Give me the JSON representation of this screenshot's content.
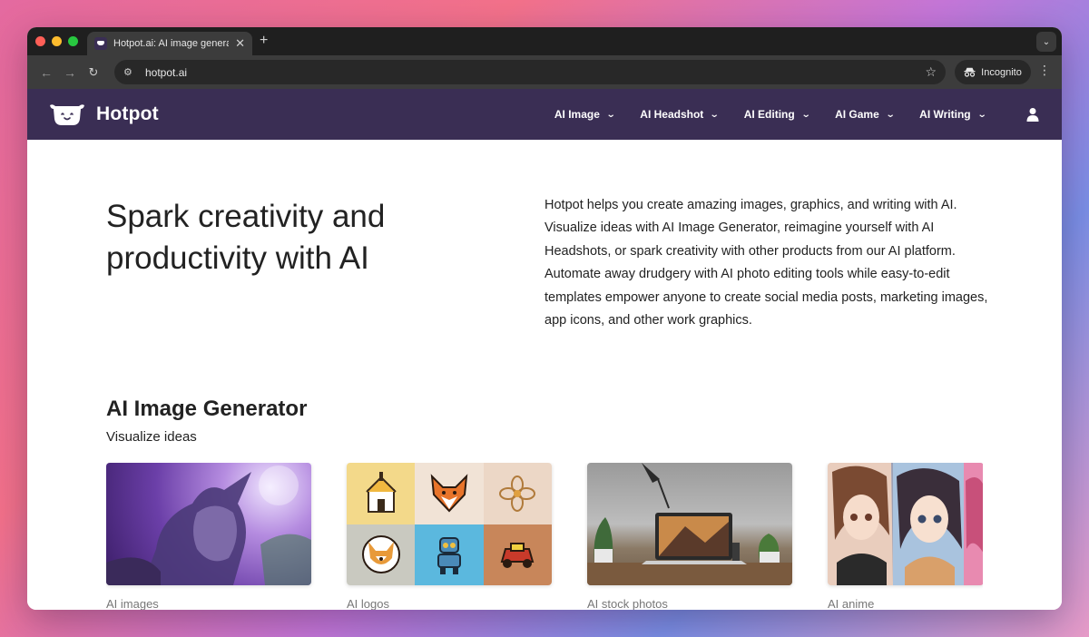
{
  "browser": {
    "tab_title": "Hotpot.ai: AI image generator",
    "url": "hotpot.ai",
    "incognito_label": "Incognito",
    "icons": {
      "back": "arrow-left-icon",
      "forward": "arrow-right-icon",
      "reload": "reload-icon",
      "site_settings": "tune-icon",
      "bookmark": "star-icon",
      "incognito": "incognito-icon",
      "menu": "kebab-icon"
    }
  },
  "site": {
    "brand": "Hotpot",
    "accent_color": "#3a2e54",
    "nav": [
      {
        "label": "AI Image"
      },
      {
        "label": "AI Headshot"
      },
      {
        "label": "AI Editing"
      },
      {
        "label": "AI Game"
      },
      {
        "label": "AI Writing"
      }
    ]
  },
  "hero": {
    "title": "Spark creativity and productivity with AI",
    "description": "Hotpot helps you create amazing images, graphics, and writing with AI. Visualize ideas with AI Image Generator, reimagine yourself with AI Headshots, or spark creativity with other products from our AI platform. Automate away drudgery with AI photo editing tools while easy-to-edit templates empower anyone to create social media posts, marketing images, app icons, and other work graphics."
  },
  "section": {
    "title": "AI Image Generator",
    "subtitle": "Visualize ideas",
    "cards": [
      {
        "label": "AI images"
      },
      {
        "label": "AI logos"
      },
      {
        "label": "AI stock photos"
      },
      {
        "label": "AI anime"
      }
    ]
  }
}
